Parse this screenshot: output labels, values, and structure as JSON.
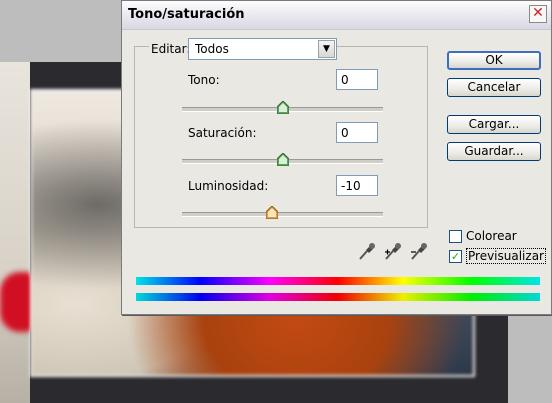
{
  "dialog": {
    "title": "Tono/saturación",
    "close_glyph": "✕"
  },
  "edit": {
    "label": "Editar:",
    "selected": "Todos"
  },
  "hue": {
    "label": "Tono:",
    "value": "0",
    "slider_fraction": 0.5
  },
  "saturation": {
    "label": "Saturación:",
    "value": "0",
    "slider_fraction": 0.5
  },
  "lightness": {
    "label": "Luminosidad:",
    "value": "-10",
    "slider_fraction": 0.45
  },
  "buttons": {
    "ok": "OK",
    "cancel": "Cancelar",
    "load": "Cargar...",
    "save": "Guardar..."
  },
  "options": {
    "colorize_label": "Colorear",
    "colorize_checked": false,
    "preview_label": "Previsualizar",
    "preview_checked": true
  },
  "icons": [
    "eyedropper-icon",
    "eyedropper-plus-icon",
    "eyedropper-minus-icon",
    "close-icon",
    "chevron-down-icon"
  ],
  "colors": {
    "titlebar": "#e6e6ee",
    "dialog_bg": "#eae8e2",
    "ok_border": "#3d6fb8",
    "check_mark": "#21a121"
  }
}
